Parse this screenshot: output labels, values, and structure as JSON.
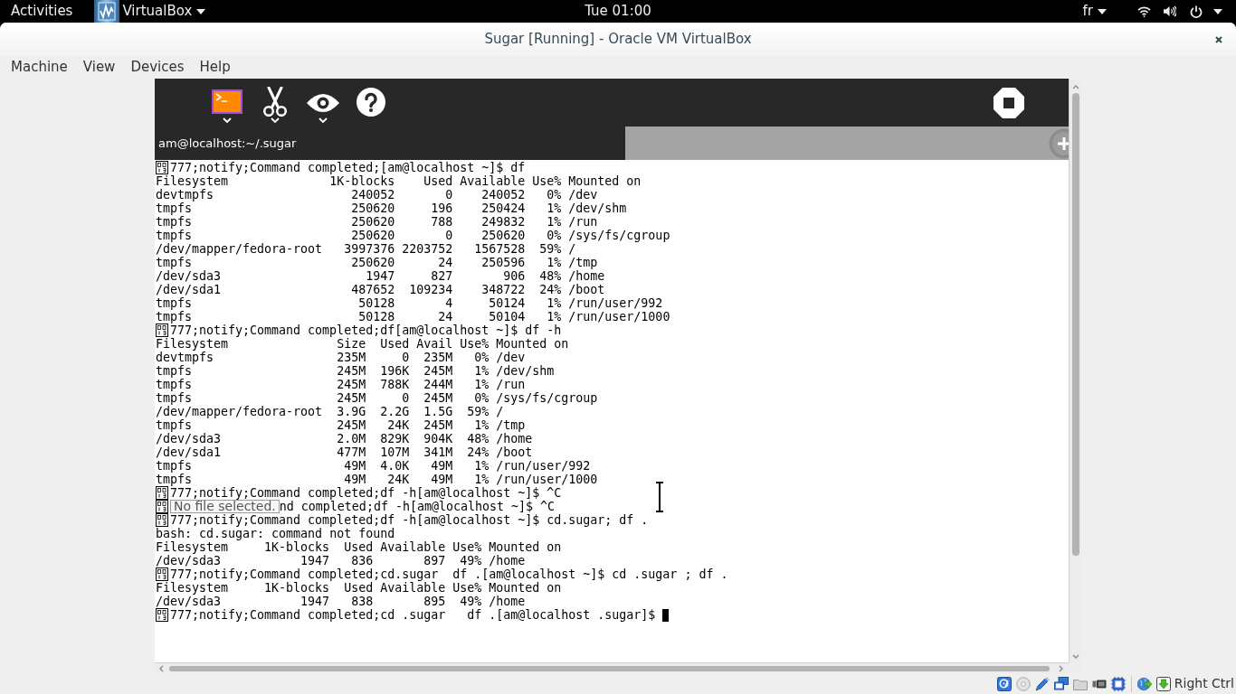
{
  "top_bar": {
    "activities": "Activities",
    "app_menu": "VirtualBox",
    "clock": "Tue 01:00",
    "keyboard_layout": "fr"
  },
  "window": {
    "title": "Sugar [Running] - Oracle VM VirtualBox"
  },
  "menu_bar": [
    "Machine",
    "View",
    "Devices",
    "Help"
  ],
  "tabs": [
    {
      "title": "am@localhost:~/.sugar",
      "selected": true
    }
  ],
  "terminal": {
    "lines": [
      {
        "glyph": true,
        "cursor": false,
        "text": "777;notify;Command completed;[am@localhost ~]$ df"
      },
      {
        "glyph": false,
        "cursor": false,
        "text": "Filesystem              1K-blocks    Used Available Use% Mounted on"
      },
      {
        "glyph": false,
        "cursor": false,
        "text": "devtmpfs                   240052       0    240052   0% /dev"
      },
      {
        "glyph": false,
        "cursor": false,
        "text": "tmpfs                      250620     196    250424   1% /dev/shm"
      },
      {
        "glyph": false,
        "cursor": false,
        "text": "tmpfs                      250620     788    249832   1% /run"
      },
      {
        "glyph": false,
        "cursor": false,
        "text": "tmpfs                      250620       0    250620   0% /sys/fs/cgroup"
      },
      {
        "glyph": false,
        "cursor": false,
        "text": "/dev/mapper/fedora-root   3997376 2203752   1567528  59% /"
      },
      {
        "glyph": false,
        "cursor": false,
        "text": "tmpfs                      250620      24    250596   1% /tmp"
      },
      {
        "glyph": false,
        "cursor": false,
        "text": "/dev/sda3                    1947     827       906  48% /home"
      },
      {
        "glyph": false,
        "cursor": false,
        "text": "/dev/sda1                  487652  109234    348722  24% /boot"
      },
      {
        "glyph": false,
        "cursor": false,
        "text": "tmpfs                       50128       4     50124   1% /run/user/992"
      },
      {
        "glyph": false,
        "cursor": false,
        "text": "tmpfs                       50128      24     50104   1% /run/user/1000"
      },
      {
        "glyph": true,
        "cursor": false,
        "text": "777;notify;Command completed;df[am@localhost ~]$ df -h"
      },
      {
        "glyph": false,
        "cursor": false,
        "text": "Filesystem               Size  Used Avail Use% Mounted on"
      },
      {
        "glyph": false,
        "cursor": false,
        "text": "devtmpfs                 235M     0  235M   0% /dev"
      },
      {
        "glyph": false,
        "cursor": false,
        "text": "tmpfs                    245M  196K  245M   1% /dev/shm"
      },
      {
        "glyph": false,
        "cursor": false,
        "text": "tmpfs                    245M  788K  244M   1% /run"
      },
      {
        "glyph": false,
        "cursor": false,
        "text": "tmpfs                    245M     0  245M   0% /sys/fs/cgroup"
      },
      {
        "glyph": false,
        "cursor": false,
        "text": "/dev/mapper/fedora-root  3.9G  2.2G  1.5G  59% /"
      },
      {
        "glyph": false,
        "cursor": false,
        "text": "tmpfs                    245M   24K  245M   1% /tmp"
      },
      {
        "glyph": false,
        "cursor": false,
        "text": "/dev/sda3                2.0M  829K  904K  48% /home"
      },
      {
        "glyph": false,
        "cursor": false,
        "text": "/dev/sda1                477M  107M  341M  24% /boot"
      },
      {
        "glyph": false,
        "cursor": false,
        "text": "tmpfs                     49M  4.0K   49M   1% /run/user/992"
      },
      {
        "glyph": false,
        "cursor": false,
        "text": "tmpfs                     49M   24K   49M   1% /run/user/1000"
      },
      {
        "glyph": true,
        "cursor": false,
        "text": "777;notify;Command completed;df -h[am@localhost ~]$ ^C"
      },
      {
        "glyph": true,
        "cursor": false,
        "tooltip": "No file selected.",
        "text": "nd completed;df -h[am@localhost ~]$ ^C"
      },
      {
        "glyph": true,
        "cursor": false,
        "text": "777;notify;Command completed;df -h[am@localhost ~]$ cd.sugar; df ."
      },
      {
        "glyph": false,
        "cursor": false,
        "text": "bash: cd.sugar: command not found"
      },
      {
        "glyph": false,
        "cursor": false,
        "text": "Filesystem     1K-blocks  Used Available Use% Mounted on"
      },
      {
        "glyph": false,
        "cursor": false,
        "text": "/dev/sda3           1947   836       897  49% /home"
      },
      {
        "glyph": true,
        "cursor": false,
        "text": "777;notify;Command completed;cd.sugar  df .[am@localhost ~]$ cd .sugar ; df ."
      },
      {
        "glyph": false,
        "cursor": false,
        "text": "Filesystem     1K-blocks  Used Available Use% Mounted on"
      },
      {
        "glyph": false,
        "cursor": false,
        "text": "/dev/sda3           1947   838       895  49% /home"
      },
      {
        "glyph": true,
        "cursor": true,
        "text": "777;notify;Command completed;cd .sugar   df .[am@localhost .sugar]$"
      }
    ]
  },
  "status_bar": {
    "host_key": "Right Ctrl"
  }
}
